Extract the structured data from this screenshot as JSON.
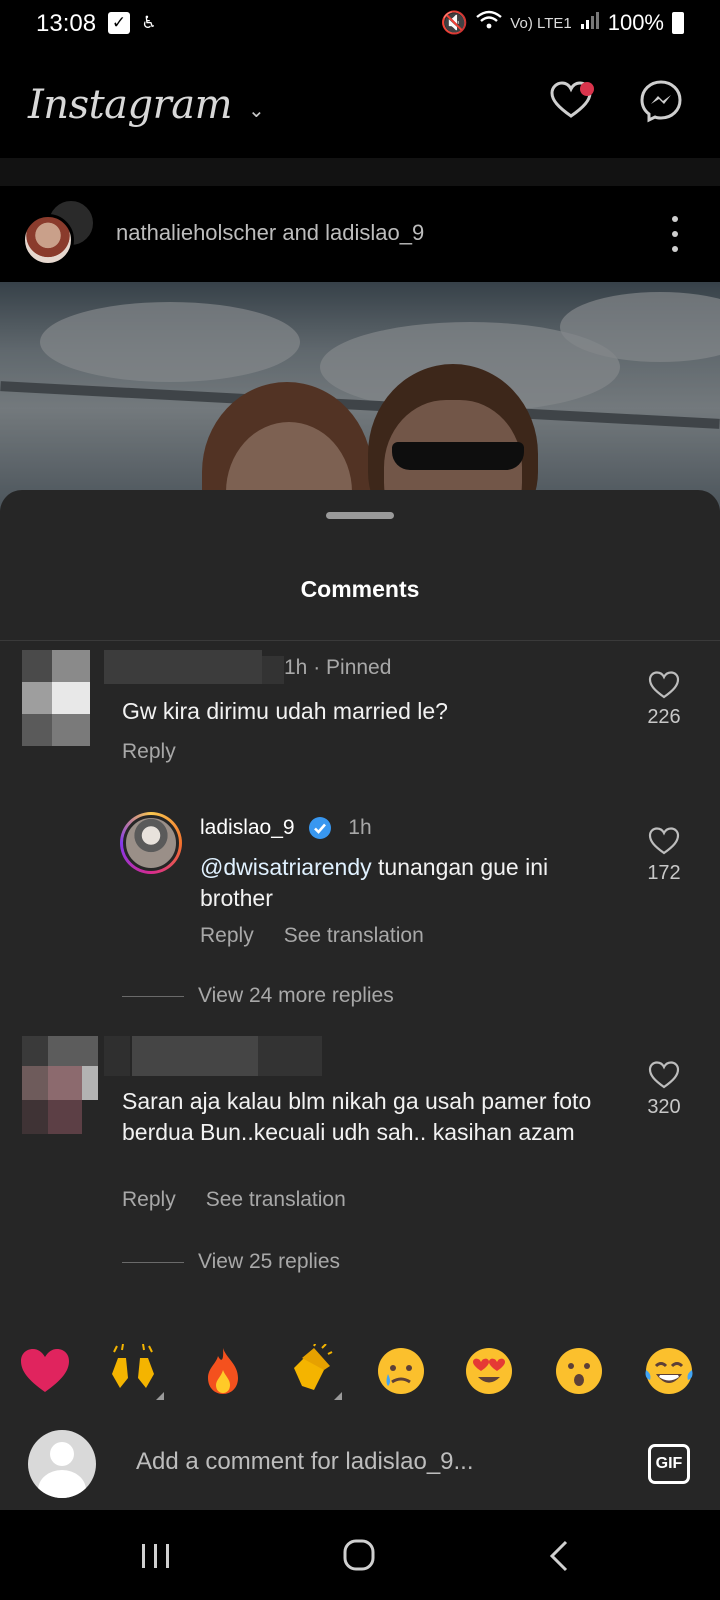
{
  "status_bar": {
    "time": "13:08",
    "left_icons": [
      "checkbox-notification-icon",
      "accessibility-icon"
    ],
    "network_label": "Vo) LTE1",
    "battery": "100%"
  },
  "app": {
    "logo": "Instagram",
    "icons": [
      "heart-icon",
      "messenger-icon"
    ],
    "notification_dot_color": "#d9344c"
  },
  "post": {
    "authors": "nathalieholscher and ladislao_9"
  },
  "sheet": {
    "title": "Comments"
  },
  "comments": [
    {
      "meta": "1h · Pinned",
      "text": "Gw kira dirimu udah married le?",
      "actions": [
        "Reply"
      ],
      "likes": "226"
    },
    {
      "username": "ladislao_9",
      "time": "1h",
      "mention": "@dwisatriarendy",
      "text": " tunangan gue ini brother",
      "actions": [
        "Reply",
        "See translation"
      ],
      "likes": "172",
      "view_replies": "View 24 more replies"
    },
    {
      "text": "Saran aja kalau blm nikah ga usah pamer foto berdua Bun..kecuali udh sah.. kasihan azam",
      "actions": [
        "Reply",
        "See translation"
      ],
      "likes": "320",
      "view_replies": "View 25 replies"
    }
  ],
  "emoji_bar": [
    "❤️",
    "🙌",
    "🔥",
    "👏",
    "😢",
    "😍",
    "😮",
    "😂"
  ],
  "composer": {
    "placeholder": "Add a comment for ladislao_9...",
    "gif_label": "GIF"
  },
  "colors": {
    "sheet_bg": "#262626",
    "like_icon": "#bdbdbd",
    "verified_badge": "#3897f0",
    "heart_emoji": "#e0245e"
  }
}
